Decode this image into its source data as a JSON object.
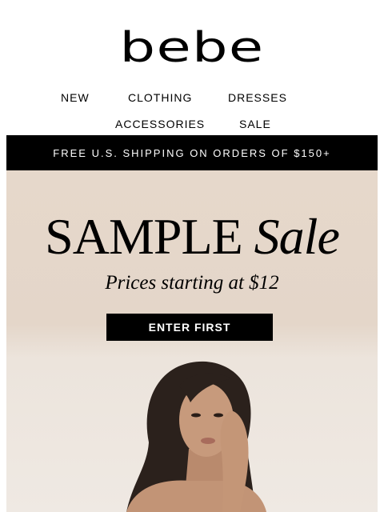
{
  "brand": {
    "logo_text": "bebe"
  },
  "nav": {
    "row1": [
      "NEW",
      "CLOTHING",
      "DRESSES"
    ],
    "row2": [
      "ACCESSORIES",
      "SALE"
    ]
  },
  "promo": {
    "text": "FREE U.S. SHIPPING ON ORDERS OF $150+"
  },
  "hero": {
    "headline_main": "SAMPLE",
    "headline_script": "Sale",
    "subheadline": "Prices starting at $12",
    "cta_label": "ENTER FIRST",
    "background_color": "#e6d8cb"
  }
}
